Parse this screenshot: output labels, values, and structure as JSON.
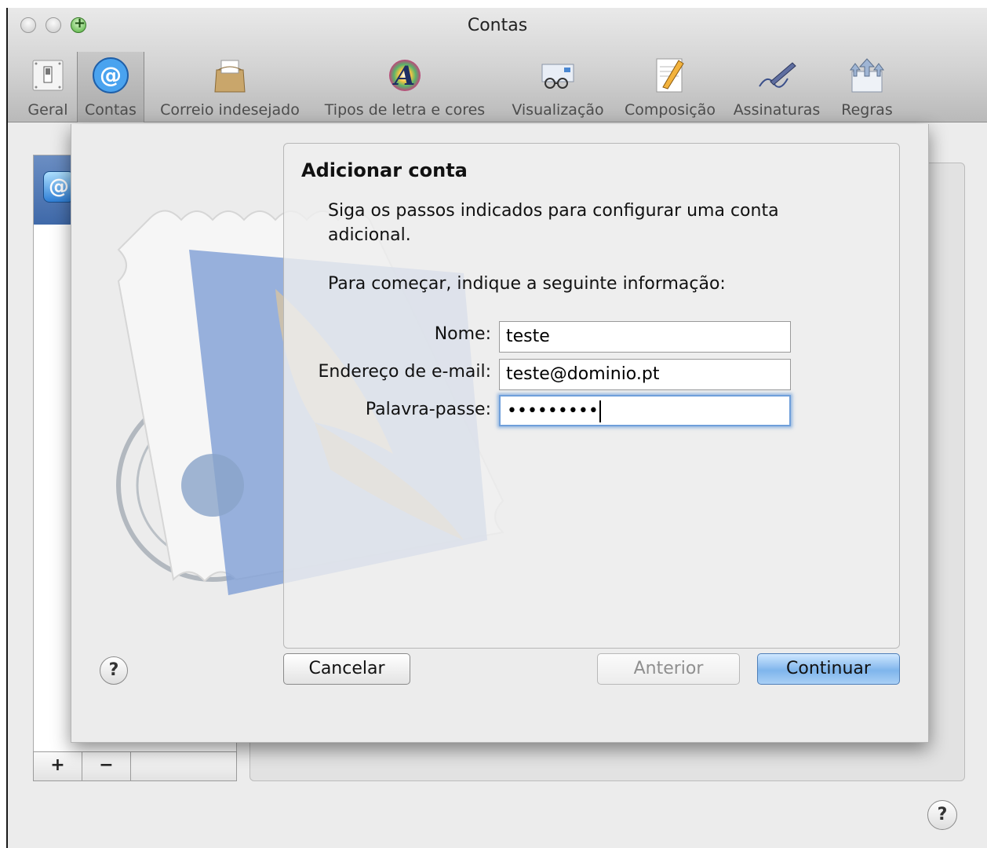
{
  "window": {
    "title": "Contas"
  },
  "toolbar": {
    "items": [
      {
        "label": "Geral",
        "icon": "switch-icon"
      },
      {
        "label": "Contas",
        "icon": "at-sign-icon"
      },
      {
        "label": "Correio indesejado",
        "icon": "junk-mail-bag-icon"
      },
      {
        "label": "Tipos de letra e cores",
        "icon": "font-color-icon"
      },
      {
        "label": "Visualização",
        "icon": "viewing-glasses-icon"
      },
      {
        "label": "Composição",
        "icon": "pencil-notepad-icon"
      },
      {
        "label": "Assinaturas",
        "icon": "signature-pen-icon"
      },
      {
        "label": "Regras",
        "icon": "rules-arrows-icon"
      }
    ],
    "selected": "Contas"
  },
  "account_list": {
    "add_label": "+",
    "remove_label": "−"
  },
  "sheet": {
    "title": "Adicionar conta",
    "intro": "Siga os passos indicados para configurar uma conta adicional.",
    "intro2": "Para começar, indique a seguinte informação:",
    "fields": {
      "name_label": "Nome:",
      "name_value": "teste",
      "email_label": "Endereço de e-mail:",
      "email_value": "teste@dominio.pt",
      "password_label": "Palavra-passe:",
      "password_value": "•••••••••"
    },
    "buttons": {
      "help": "?",
      "cancel": "Cancelar",
      "back": "Anterior",
      "continue": "Continuar"
    }
  },
  "help_button": "?",
  "colors": {
    "primary_button": "#7fb5ec",
    "focus_ring": "#6f9fda",
    "selection": "#3f69a9"
  }
}
